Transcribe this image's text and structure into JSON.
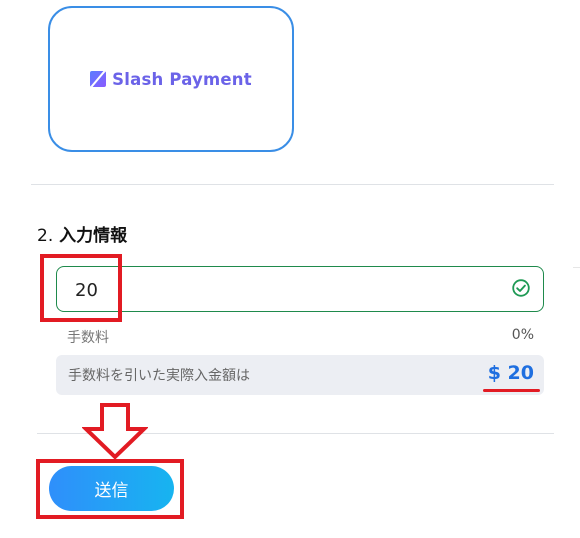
{
  "payment_method": {
    "logo_text": "Slash Payment",
    "logo_icon": "slash-logo-icon",
    "border_color": "#3a8ee6"
  },
  "section": {
    "number": "2.",
    "title": "入力情報"
  },
  "amount_input": {
    "value": "20",
    "status_icon": "check-circle-icon",
    "border_color": "#1f8a4c"
  },
  "fee": {
    "label": "手数料",
    "value": "0%"
  },
  "net_amount": {
    "label": "手数料を引いた実際入金額は",
    "value": "$ 20",
    "color": "#1f6fe0"
  },
  "submit": {
    "label": "送信"
  },
  "annotations": {
    "color": "#e21b23",
    "arrow_icon": "down-arrow-icon"
  }
}
